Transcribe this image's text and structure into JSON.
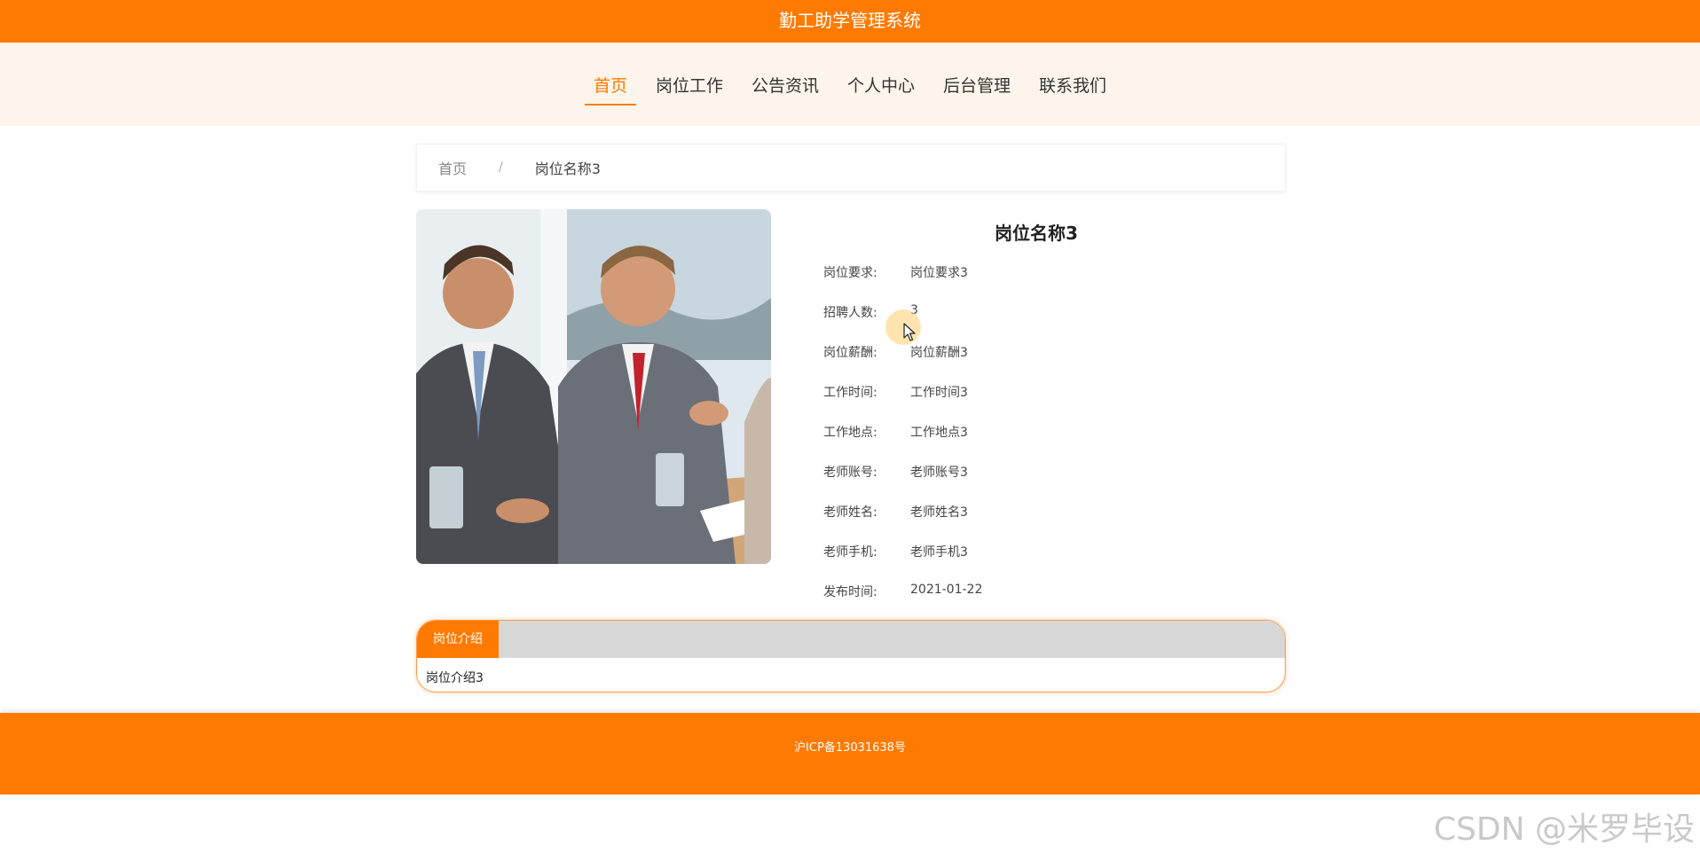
{
  "header": {
    "title": "勤工助学管理系统"
  },
  "nav": {
    "items": [
      {
        "label": "首页",
        "active": true
      },
      {
        "label": "岗位工作",
        "active": false
      },
      {
        "label": "公告资讯",
        "active": false
      },
      {
        "label": "个人中心",
        "active": false
      },
      {
        "label": "后台管理",
        "active": false
      },
      {
        "label": "联系我们",
        "active": false
      }
    ]
  },
  "breadcrumb": {
    "home": "首页",
    "separator": "/",
    "current": "岗位名称3"
  },
  "detail": {
    "title": "岗位名称3",
    "fields": [
      {
        "label": "岗位要求:",
        "value": "岗位要求3"
      },
      {
        "label": "招聘人数:",
        "value": "3"
      },
      {
        "label": "岗位薪酬:",
        "value": "岗位薪酬3"
      },
      {
        "label": "工作时间:",
        "value": "工作时间3"
      },
      {
        "label": "工作地点:",
        "value": "工作地点3"
      },
      {
        "label": "老师账号:",
        "value": "老师账号3"
      },
      {
        "label": "老师姓名:",
        "value": "老师姓名3"
      },
      {
        "label": "老师手机:",
        "value": "老师手机3"
      },
      {
        "label": "发布时间:",
        "value": "2021-01-22"
      }
    ]
  },
  "intro": {
    "tab_label": "岗位介绍",
    "content": "岗位介绍3"
  },
  "footer": {
    "icp": "沪ICP备13031638号"
  },
  "watermark": "CSDN @米罗毕设",
  "colors": {
    "accent": "#ff7a00",
    "nav_bg": "#fdf5ec"
  }
}
